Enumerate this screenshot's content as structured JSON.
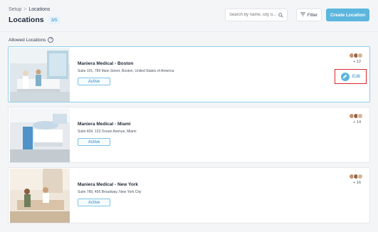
{
  "breadcrumb": {
    "root": "Setup",
    "separator": ">",
    "current": "Locations"
  },
  "header": {
    "title": "Locations",
    "count": "3/5",
    "search_placeholder": "Search by name, city o...",
    "filter_label": "Filter",
    "create_label": "Create Location"
  },
  "section": {
    "label": "Allowed Locations",
    "help": "?"
  },
  "locations": [
    {
      "name": "Maniera Medical - Boston",
      "address": "Suite 101, 789 Main Street, Boston, United States of America",
      "status": "Active",
      "more": "+ 12",
      "edit_label": "Edit"
    },
    {
      "name": "Maniera Medical - Miami",
      "address": "Suite 404, 123 Ocean Avenue, Miami",
      "status": "Active",
      "more": "+ 14"
    },
    {
      "name": "Maniera Medical - New York",
      "address": "Suite 789, 456 Broadway, New York City",
      "status": "Active",
      "more": "+ 16"
    }
  ],
  "colors": {
    "accent": "#5cb6de",
    "highlight": "#d9272e",
    "selected_border": "#8fd0ec"
  },
  "icons": {
    "search": "search-icon",
    "filter": "filter-icon",
    "help": "help-icon",
    "edit": "pencil-icon"
  }
}
